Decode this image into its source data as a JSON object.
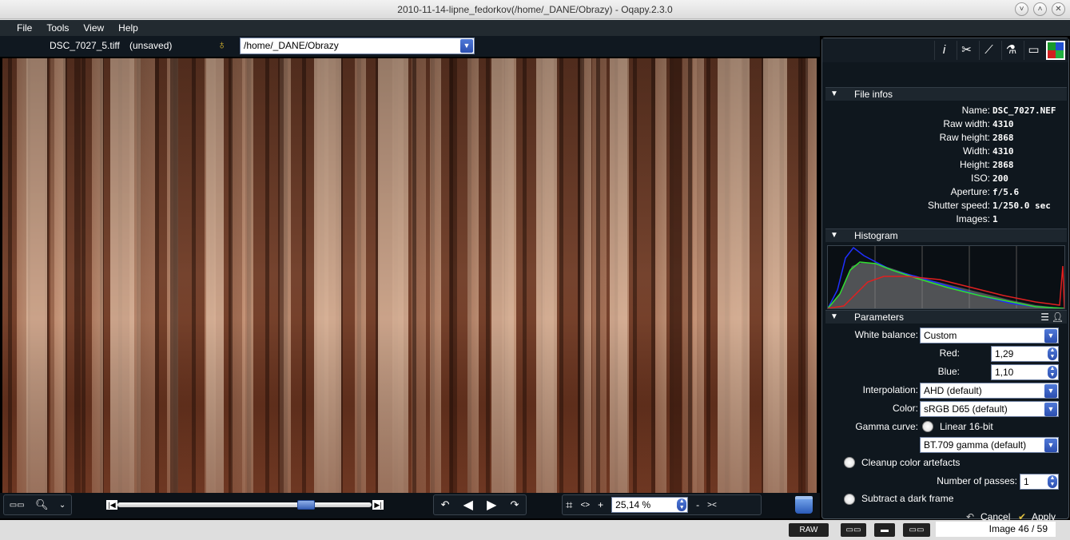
{
  "window": {
    "title": "2010-11-14-lipne_fedorkov(/home/_DANE/Obrazy) - Oqapy.2.3.0",
    "buttons": [
      "˅",
      "˄",
      "✕"
    ]
  },
  "menu": {
    "items": [
      {
        "label": "File"
      },
      {
        "label": "Tools"
      },
      {
        "label": "View"
      },
      {
        "label": "Help"
      }
    ]
  },
  "file_line": {
    "filename": "DSC_7027_5.tiff",
    "status": "(unsaved)",
    "path": "/home/_DANE/Obrazy"
  },
  "toolbar": {
    "zoom_value": "25,14 %",
    "crop_icon": "crop-icon",
    "fit_label": "<>",
    "plus_label": "+",
    "minus_label": "-",
    "fit_out_label": "><",
    "nav_prev_label": "◀",
    "nav_next_label": "▶",
    "slider_position": 0.76
  },
  "file_infos": {
    "title": "File infos",
    "rows": [
      {
        "label": "Name:",
        "value": "DSC_7027.NEF"
      },
      {
        "label": "Raw width:",
        "value": "4310"
      },
      {
        "label": "Raw height:",
        "value": "2868"
      },
      {
        "label": "Width:",
        "value": "4310"
      },
      {
        "label": "Height:",
        "value": "2868"
      },
      {
        "label": "ISO:",
        "value": "200"
      },
      {
        "label": "Aperture:",
        "value": "f/5.6"
      },
      {
        "label": "Shutter speed:",
        "value": "1/250.0 sec"
      },
      {
        "label": "Images:",
        "value": "1"
      }
    ]
  },
  "histogram": {
    "title": "Histogram"
  },
  "parameters": {
    "title": "Parameters",
    "white_balance_label": "White balance:",
    "white_balance_value": "Custom",
    "red_label": "Red:",
    "red_value": "1,29",
    "blue_label": "Blue:",
    "blue_value": "1,10",
    "interpolation_label": "Interpolation:",
    "interpolation_value": "AHD (default)",
    "color_label": "Color:",
    "color_value": "sRGB D65 (default)",
    "gamma_label": "Gamma curve:",
    "gamma_linear_label": "Linear 16-bit",
    "gamma_value": "BT.709 gamma (default)",
    "cleanup_label": "Cleanup color artefacts",
    "passes_label": "Number of passes:",
    "passes_value": "1",
    "dark_frame_label": "Subtract a dark frame",
    "cancel_label": "Cancel",
    "apply_label": "Apply"
  },
  "status_bar": {
    "raw_label": "RAW",
    "image_counter": "Image 46 / 59"
  }
}
